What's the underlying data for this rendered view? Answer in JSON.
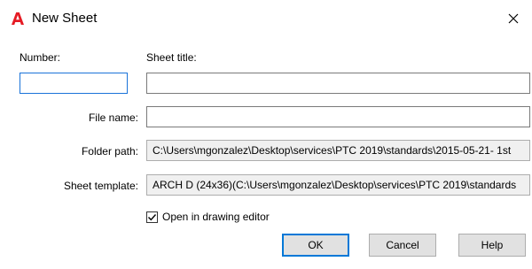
{
  "window": {
    "title": "New Sheet"
  },
  "fields": {
    "number_label": "Number:",
    "number_value": "",
    "sheet_title_label": "Sheet title:",
    "sheet_title_value": "",
    "file_name_label": "File name:",
    "file_name_value": "",
    "folder_path_label": "Folder path:",
    "folder_path_value": "C:\\Users\\mgonzalez\\Desktop\\services\\PTC 2019\\standards\\2015-05-21- 1st",
    "sheet_template_label": "Sheet template:",
    "sheet_template_value": "ARCH D (24x36)(C:\\Users\\mgonzalez\\Desktop\\services\\PTC 2019\\standards"
  },
  "options": {
    "open_in_editor_label": "Open in drawing editor",
    "open_in_editor_checked": true
  },
  "buttons": {
    "ok": "OK",
    "cancel": "Cancel",
    "help": "Help"
  },
  "colors": {
    "logo_red": "#e51b24",
    "focus_blue": "#1a73d9",
    "default_button_border": "#0078d7"
  }
}
